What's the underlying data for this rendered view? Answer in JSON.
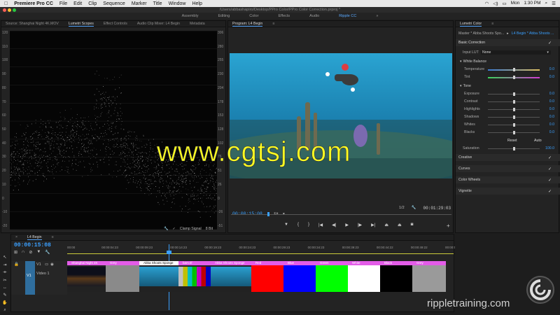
{
  "menubar": {
    "apple": "",
    "app": "Premiere Pro CC",
    "items": [
      "File",
      "Edit",
      "Clip",
      "Sequence",
      "Marker",
      "Title",
      "Window",
      "Help"
    ],
    "day": "Mon",
    "time": "1:30 PM"
  },
  "window": {
    "title": "/Users/abbashapiro/Desktop/PPro Color/PPro Color Correction.prproj *"
  },
  "workspaces": {
    "items": [
      "Assembly",
      "Editing",
      "Color",
      "Effects",
      "Audio",
      "Ripple CC"
    ],
    "active": "Ripple CC",
    "more": "»"
  },
  "scopes": {
    "tabs": [
      "Source: Shanghai Night 4K.MOV",
      "Lumetri Scopes",
      "Effect Controls",
      "Audio Clip Mixer: L4 Begin",
      "Metadata"
    ],
    "active_tab": "Lumetri Scopes",
    "left_axis": [
      "120",
      "110",
      "100",
      "90",
      "80",
      "70",
      "60",
      "50",
      "40",
      "30",
      "20",
      "10",
      "0",
      "-10",
      "-20"
    ],
    "right_axis": [
      "306",
      "280",
      "255",
      "230",
      "204",
      "178",
      "153",
      "128",
      "102",
      "76",
      "51",
      "26",
      "0",
      "-26",
      "-51"
    ],
    "clamp_label": "Clamp Signal",
    "bit_depth": "8 Bit"
  },
  "program": {
    "title": "Program: L4 Begin",
    "menu": "≡",
    "timecode": "00:00:15:08",
    "fit": "Fit",
    "resolution": "1/2",
    "duration": "00:01:29:03"
  },
  "lumetri": {
    "title": "Lumetri Color",
    "menu": "≡",
    "master": "Master * Abba Shoots Spo...",
    "clip": "L4 Begin * Abba Shoots ...",
    "basic": "Basic Correction",
    "input_lut_label": "Input LUT",
    "input_lut_value": "None",
    "white_balance": "White Balance",
    "temperature": {
      "label": "Temperature",
      "value": "0.0"
    },
    "tint": {
      "label": "Tint",
      "value": "0.0"
    },
    "tone": "Tone",
    "exposure": {
      "label": "Exposure",
      "value": "0.0"
    },
    "contrast": {
      "label": "Contrast",
      "value": "0.0"
    },
    "highlights": {
      "label": "Highlights",
      "value": "0.0"
    },
    "shadows": {
      "label": "Shadows",
      "value": "0.0"
    },
    "whites": {
      "label": "Whites",
      "value": "0.0"
    },
    "blacks": {
      "label": "Blacks",
      "value": "0.0"
    },
    "reset": "Reset",
    "auto": "Auto",
    "saturation": {
      "label": "Saturation",
      "value": "100.0"
    },
    "sections": [
      "Creative",
      "Curves",
      "Color Wheels",
      "Vignette"
    ]
  },
  "timeline": {
    "tab": "L4 Begin",
    "menu": "≡",
    "timecode": "00:00:15:08",
    "ruler": [
      "00:00",
      "00:00:04:23",
      "00:00:09:23",
      "00:00:14:23",
      "00:00:19:23",
      "00:00:24:23",
      "00:00:29:23",
      "00:00:34:23",
      "00:00:39:23",
      "00:00:44:22",
      "00:00:49:22",
      "00:00:54:22"
    ],
    "track_v1": "V1",
    "track_name": "Video 1",
    "clips": [
      {
        "name": "Shanghai Night 4K",
        "color": "#2b2b2b",
        "kind": "city"
      },
      {
        "name": "Grey",
        "color": "#8a8a8a",
        "kind": "solid"
      },
      {
        "name": "Abba Shoots Sponge",
        "color": "#1d6d9a",
        "kind": "underwater"
      },
      {
        "name": "bars.tif",
        "color": "#bbbbbb",
        "kind": "bars"
      },
      {
        "name": "Abba Shoots Sponge",
        "color": "#1d6d9a",
        "kind": "underwater"
      },
      {
        "name": "Red",
        "color": "#ff0000",
        "kind": "solid"
      },
      {
        "name": "Blue",
        "color": "#0000ff",
        "kind": "solid"
      },
      {
        "name": "Green",
        "color": "#00ff00",
        "kind": "solid"
      },
      {
        "name": "White",
        "color": "#ffffff",
        "kind": "solid"
      },
      {
        "name": "Black",
        "color": "#000000",
        "kind": "solid"
      },
      {
        "name": "Grey",
        "color": "#9a9a9a",
        "kind": "solid"
      }
    ]
  },
  "watermark": "www.cgtsj.com",
  "brand": "rippletraining.com",
  "colors": {
    "accent": "#3aa0ff",
    "watermark": "#ffff22",
    "clip_label": "#e35ce8"
  }
}
